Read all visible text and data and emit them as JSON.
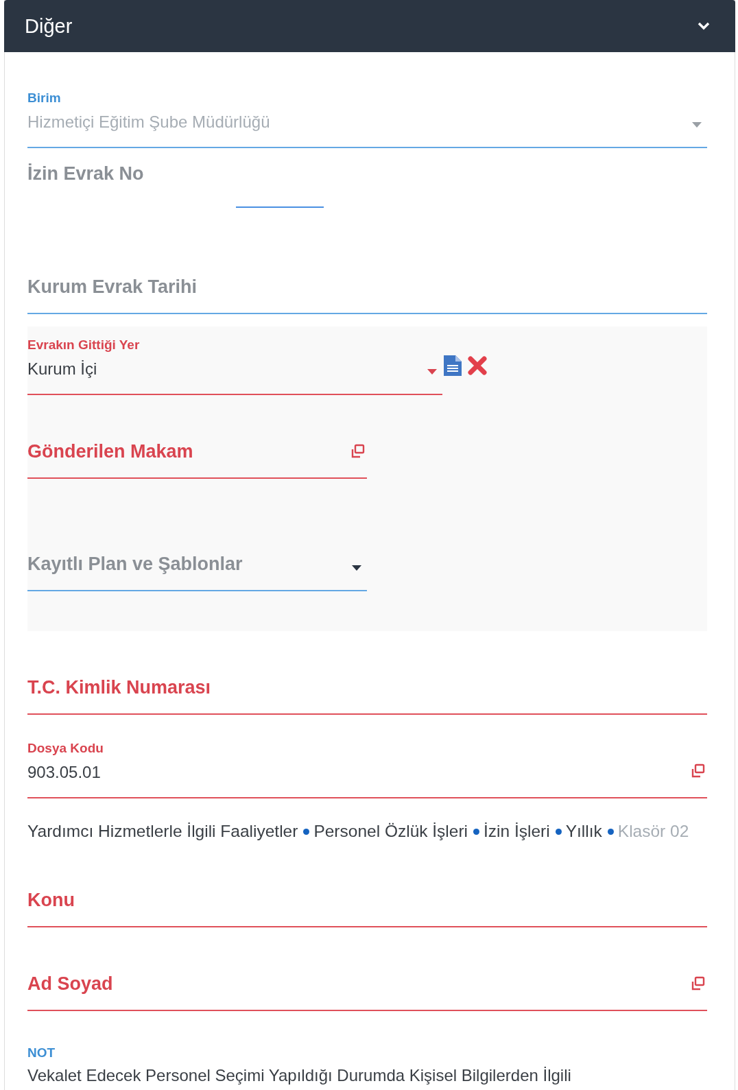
{
  "panel": {
    "title": "Diğer",
    "expanded": true
  },
  "fields": [
    {
      "kind": "select",
      "label": "Birim",
      "value": "Hizmetiçi Eğitim Şube Müdürlüğü",
      "disabled": true,
      "invalid": false
    },
    {
      "kind": "short",
      "label": "İzin Evrak No",
      "invalid": false
    },
    {
      "kind": "text",
      "label": "Kurum Evrak Tarihi",
      "invalid": false
    },
    {
      "kind": "group",
      "children": [
        {
          "kind": "select",
          "label": "Evrakın Gittiği Yer",
          "value": "Kurum İçi",
          "disabled": false,
          "invalid": true,
          "actions": true
        },
        {
          "kind": "lookup",
          "label": "Gönderilen Makam",
          "invalid": true
        },
        {
          "kind": "select",
          "label": "Kayıtlı Plan ve Şablonlar",
          "invalid": false
        }
      ]
    },
    {
      "kind": "text",
      "label": "T.C. Kimlik Numarası",
      "invalid": true
    },
    {
      "kind": "lookup",
      "label": "Dosya Kodu",
      "value": "903.05.01",
      "invalid": true
    },
    {
      "kind": "path",
      "items": [
        {
          "text": "Yardımcı Hizmetlerle İlgili Faaliyetler",
          "muted": false
        },
        {
          "text": "Personel Özlük İşleri",
          "muted": false
        },
        {
          "text": "İzin İşleri",
          "muted": false
        },
        {
          "text": "Yıllık",
          "muted": false
        },
        {
          "text": "Klasör 02",
          "muted": true
        }
      ]
    },
    {
      "kind": "text",
      "label": "Konu",
      "invalid": true
    },
    {
      "kind": "lookup",
      "label": "Ad Soyad",
      "invalid": true
    },
    {
      "kind": "textarea",
      "label": "NOT",
      "value": "Vekalet Edecek Personel Seçimi Yapıldığı Durumda Kişisel Bilgilerden İlgili",
      "invalid": false
    }
  ]
}
